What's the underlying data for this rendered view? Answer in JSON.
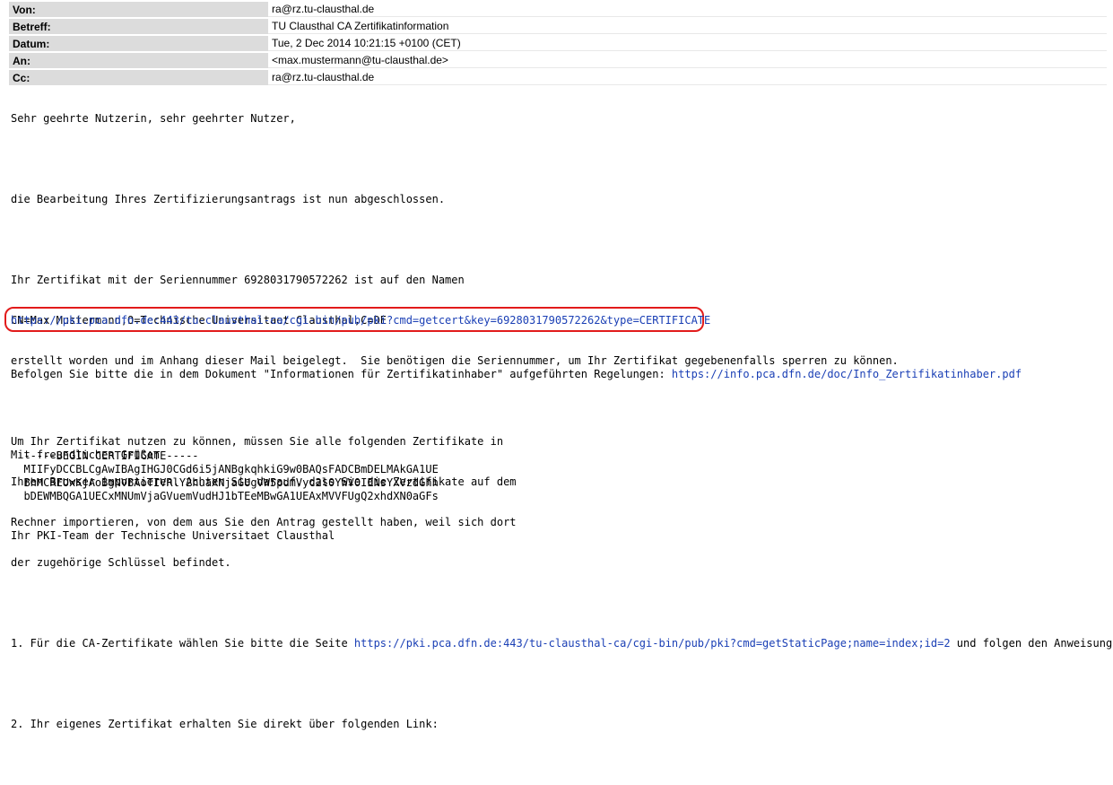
{
  "header": {
    "rows": [
      {
        "label": "Von:",
        "value": "ra@rz.tu-clausthal.de"
      },
      {
        "label": "Betreff:",
        "value": "TU Clausthal CA Zertifikatinformation"
      },
      {
        "label": "Datum:",
        "value": "Tue, 2 Dec 2014 10:21:15 +0100 (CET)"
      },
      {
        "label": "An:",
        "value": "<max.mustermann@tu-clausthal.de>"
      },
      {
        "label": "Cc:",
        "value": "ra@rz.tu-clausthal.de"
      }
    ]
  },
  "body": {
    "greeting": "Sehr geehrte Nutzerin, sehr geehrter Nutzer,",
    "p1": "die Bearbeitung Ihres Zertifizierungsantrags ist nun abgeschlossen.",
    "p2_l1": "Ihr Zertifikat mit der Seriennummer 6928031790572262 ist auf den Namen",
    "p2_l2": "CN=Max Mustermann,O=Technische Universitaet Clausthal,C=DE",
    "p2_l3": "erstellt worden und im Anhang dieser Mail beigelegt.  Sie benötigen die Seriennummer, um Ihr Zertifikat gegebenenfalls sperren zu können.",
    "p3_l1": "Um Ihr Zertifikat nutzen zu können, müssen Sie alle folgenden Zertifikate in",
    "p3_l2": "Ihren Browser importieren. Achten Sie darauf, dass Sie die Zertifikate auf dem",
    "p3_l3": "Rechner importieren, von dem aus Sie den Antrag gestellt haben, weil sich dort",
    "p3_l4": "der zugehörige Schlüssel befindet.",
    "step1_pre": "1. Für die CA-Zertifikate wählen Sie bitte die Seite ",
    "step1_link": "https://pki.pca.dfn.de:443/tu-clausthal-ca/cgi-bin/pub/pki?cmd=getStaticPage;name=index;id=2",
    "step1_post": " und folgen den Anweisungen.",
    "step2": "2. Ihr eigenes Zertifikat erhalten Sie direkt über folgenden Link:",
    "cert_link": "https://pki.pca.dfn.de:443/tu-clausthal-ca/cgi-bin/pub/pki?cmd=getcert&key=6928031790572262&type=CERTIFICATE",
    "rules_pre": "Befolgen Sie bitte die in dem Dokument \"Informationen für Zertifikatinhaber\" aufgeführten Regelungen: ",
    "rules_link": "https://info.pca.dfn.de/doc/Info_Zertifikatinhaber.pdf",
    "closing": "Mit freundlichen Grüßen",
    "signature": "Ihr PKI-Team der Technische Universitaet Clausthal"
  },
  "certificate": {
    "begin": "-----BEGIN CERTIFICATE-----",
    "line1": "MIIFyDCCBLCgAwIBAgIHGJ0CGd6i5jANBgkqhkiG9w0BAQsFADCBmDELMAkGA1UE",
    "line2": "BhMCREUxKjAoBgNVBAoTIVRlY2huaXNjaGUgVW5pdmVyc2l0YWV0IENsYXVzdGhh",
    "line3": "bDEWMBQGA1UECxMNUmVjaGVuemVudHJ1bTEeMBwGA1UEAxMVVFUgQ2xhdXN0aGFs"
  }
}
